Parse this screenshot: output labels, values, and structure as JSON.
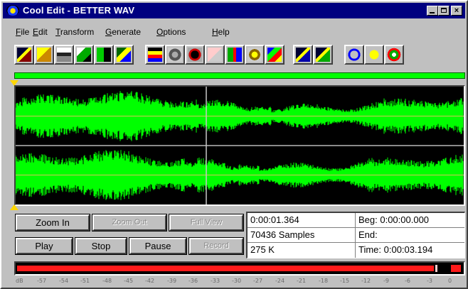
{
  "window": {
    "title": "Cool Edit - BETTER WAV",
    "min_glyph": "",
    "max_glyph": "",
    "close_glyph": "×"
  },
  "menu": {
    "items": [
      {
        "ul": "F",
        "rest": "ile"
      },
      {
        "ul": "E",
        "rest": "dit"
      },
      {
        "ul": "T",
        "rest": "ransform"
      },
      {
        "ul": "G",
        "rest": "enerate"
      },
      {
        "ul": "O",
        "rest": "ptions"
      },
      {
        "ul": "H",
        "rest": "elp"
      }
    ]
  },
  "toolbar": {
    "icons": [
      "open-wave-icon",
      "open-folder-icon",
      "save-icon",
      "record-to-file-icon",
      "append-icon",
      "mix-paste-icon",
      "echo-icon",
      "filter-icon",
      "reverb-icon",
      "noise-icon",
      "amplify-icon",
      "brightness-icon",
      "spectral-icon",
      "cue-list-icon",
      "playlist-icon",
      "loop-icon",
      "help-icon",
      "cd-icon"
    ]
  },
  "transport": {
    "zoom_in": "Zoom In",
    "zoom_out": "Zoom Out",
    "full_view": "Full View",
    "play": "Play",
    "stop": "Stop",
    "pause": "Pause",
    "record": "Record"
  },
  "info": {
    "position": "0:00:01.364",
    "samples": "70436 Samples",
    "size": "275 K",
    "begin": "Beg: 0:00:00.000",
    "end": "End:",
    "time": "Time: 0:00:03.194"
  },
  "meter": {
    "level_fraction": 0.955,
    "scale_labels": [
      "dB",
      "-57",
      "-54",
      "-51",
      "-48",
      "-45",
      "-42",
      "-39",
      "-36",
      "-33",
      "-30",
      "-27",
      "-24",
      "-21",
      "-18",
      "-15",
      "-12",
      "-9",
      "-6",
      "-3",
      "0"
    ]
  },
  "colors": {
    "waveform": "#00ff00",
    "background": "#000000",
    "meter": "#ff1a1a",
    "title_bar": "#000080"
  }
}
